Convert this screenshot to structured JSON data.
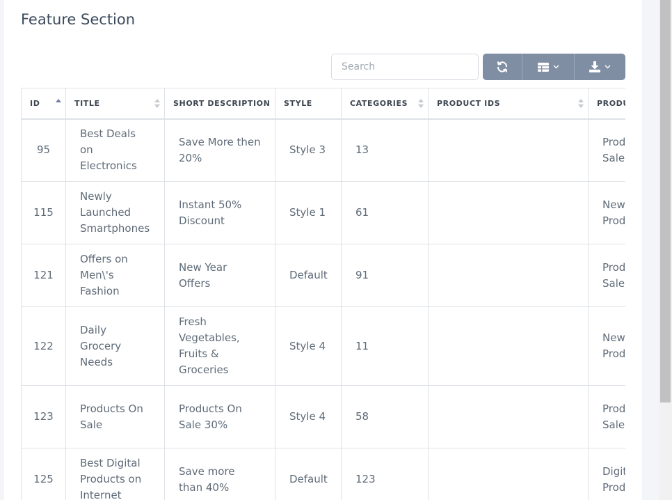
{
  "page": {
    "title": "Feature Section"
  },
  "toolbar": {
    "search_placeholder": "Search",
    "buttons": [
      {
        "icon": "refresh-icon"
      },
      {
        "icon": "columns-icon",
        "dropdown": true
      },
      {
        "icon": "download-icon",
        "dropdown": true
      }
    ],
    "button_color": "#7f8ea3"
  },
  "table": {
    "columns": [
      "ID",
      "TITLE",
      "SHORT DESCRIPTION",
      "STYLE",
      "CATEGORIES",
      "PRODUCT IDS",
      "PRODU"
    ],
    "sort": {
      "column": "ID",
      "direction": "asc"
    },
    "rows": [
      {
        "id": "95",
        "title": "Best Deals on Electronics",
        "desc": "Save More then 20%",
        "style": "Style 3",
        "categories": "13",
        "product_ids": "",
        "product_type": [
          "Prod",
          "Sale"
        ]
      },
      {
        "id": "115",
        "title": "Newly Launched Smartphones",
        "desc": "Instant 50% Discount",
        "style": "Style 1",
        "categories": "61",
        "product_ids": "",
        "product_type": [
          "New",
          "Prod"
        ]
      },
      {
        "id": "121",
        "title": "Offers on Men\\'s Fashion",
        "desc": "New Year Offers",
        "style": "Default",
        "categories": "91",
        "product_ids": "",
        "product_type": [
          "Prod",
          "Sale"
        ]
      },
      {
        "id": "122",
        "title": "Daily Grocery Needs",
        "desc": "Fresh Vegetables, Fruits & Groceries",
        "style": "Style 4",
        "categories": "11",
        "product_ids": "",
        "product_type": [
          "New",
          "Prod"
        ]
      },
      {
        "id": "123",
        "title": "Products On Sale",
        "desc": "Products On Sale 30%",
        "style": "Style 4",
        "categories": "58",
        "product_ids": "",
        "product_type": [
          "Prod",
          "Sale"
        ]
      },
      {
        "id": "125",
        "title": "Best Digital Products on Internet",
        "desc": "Save more than 40%",
        "style": "Default",
        "categories": "123",
        "product_ids": "",
        "product_type": [
          "Digit",
          "Prod"
        ]
      }
    ]
  }
}
